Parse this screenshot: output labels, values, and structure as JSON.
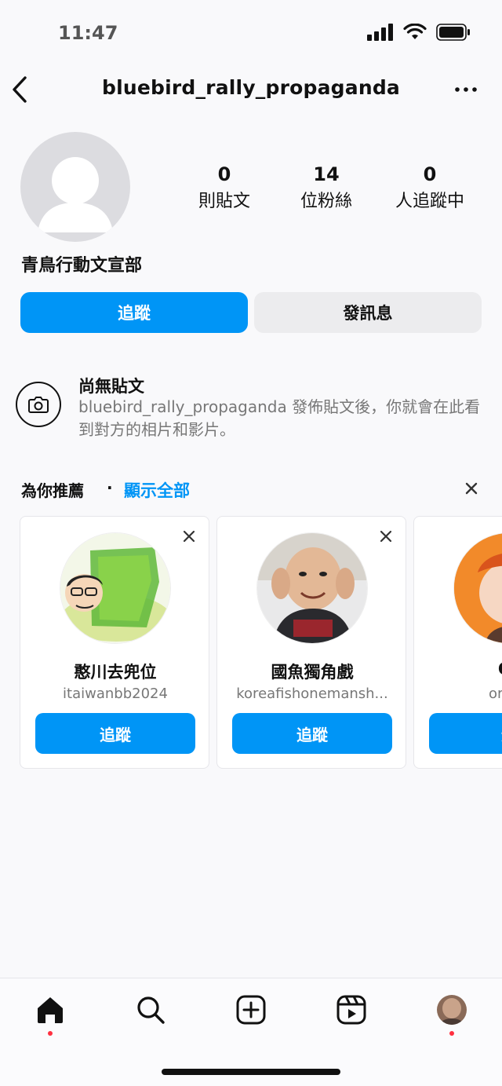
{
  "status_bar": {
    "time": "11:47"
  },
  "header": {
    "username": "bluebird_rally_propaganda"
  },
  "profile": {
    "display_name": "青鳥行動文宣部",
    "stats": [
      {
        "number": "0",
        "label": "則貼文"
      },
      {
        "number": "14",
        "label": "位粉絲"
      },
      {
        "number": "0",
        "label": "人追蹤中"
      }
    ],
    "follow_label": "追蹤",
    "message_label": "發訊息"
  },
  "no_posts": {
    "title": "尚無貼文",
    "description": "bluebird_rally_propaganda 發佈貼文後，你就會在此看到對方的相片和影片。"
  },
  "suggestions": {
    "title": "為你推薦",
    "separator": "·",
    "see_all": "顯示全部",
    "cards": [
      {
        "name": "憨川去兜位",
        "handle": "itaiwanbb2024",
        "follow_label": "追蹤"
      },
      {
        "name": "國魚獨角戲",
        "handle": "koreafishonemansh...",
        "follow_label": "追蹤"
      },
      {
        "name": "Or",
        "handle": "orane",
        "follow_label": "追"
      }
    ]
  },
  "tabs": [
    "home-icon",
    "search-icon",
    "create-icon",
    "reels-icon",
    "profile-avatar"
  ],
  "colors": {
    "accent": "#0095f6",
    "notification": "#ff3040"
  }
}
